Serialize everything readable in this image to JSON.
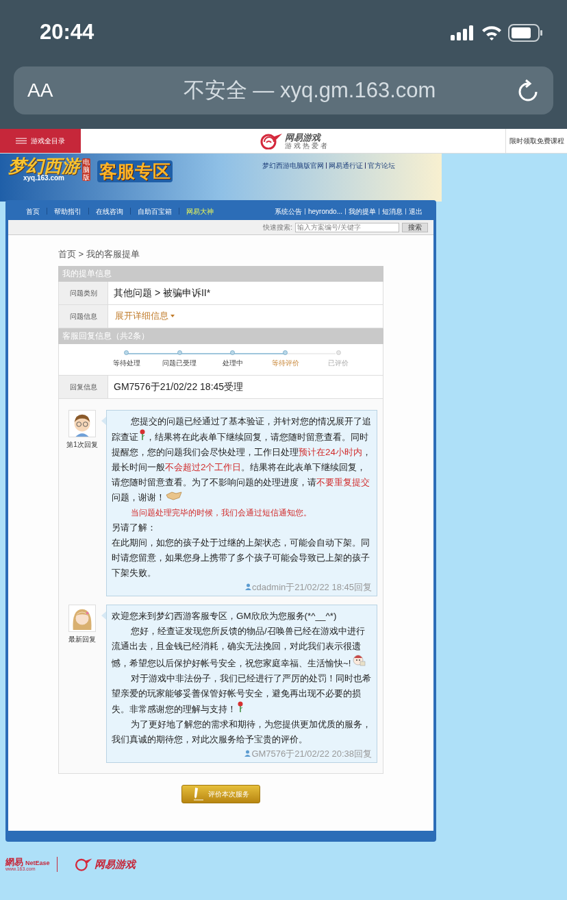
{
  "status_bar": {
    "time": "20:44"
  },
  "address_bar": {
    "text_size_button": "AA",
    "url": "不安全 — xyq.gm.163.com"
  },
  "site_bar": {
    "menu": "游戏全目录",
    "brand": "网易游戏",
    "brand_tagline": "游 戏 热 爱 者",
    "promo": "限时领取免费课程"
  },
  "banner": {
    "game_logo": "梦幻西游",
    "edition_badge": "电脑版",
    "game_url": "xyq.163.com",
    "title": "客服专区",
    "links": [
      "梦幻西游电脑版官网",
      "网易通行证",
      "官方论坛"
    ]
  },
  "nav": {
    "items": [
      {
        "label": "首页",
        "highlight": false
      },
      {
        "label": "帮助指引",
        "highlight": false
      },
      {
        "label": "在线咨询",
        "highlight": false
      },
      {
        "label": "自助百宝箱",
        "highlight": false
      },
      {
        "label": "网易大神",
        "highlight": true
      }
    ],
    "user_links": [
      "系统公告",
      "heyrondo...",
      "我的提单",
      "短消息",
      "退出"
    ]
  },
  "search": {
    "label": "快速搜索:",
    "placeholder": "输入方案编号/关键字",
    "button": "搜索"
  },
  "breadcrumb": "首页 > 我的客服提单",
  "ticket": {
    "heading": "我的提单信息",
    "rows": [
      {
        "label": "问题类别",
        "value": "其他问题 > 被骗申诉II*",
        "kind": "text"
      },
      {
        "label": "问题信息",
        "value": "展开详细信息",
        "kind": "link"
      }
    ]
  },
  "replies_section": {
    "heading": "客服回复信息（共2条）",
    "steps": [
      {
        "label": "等待处理",
        "completed": true,
        "selected": false
      },
      {
        "label": "问题已受理",
        "completed": true,
        "selected": false
      },
      {
        "label": "处理中",
        "completed": true,
        "selected": false
      },
      {
        "label": "等待评价",
        "completed": true,
        "selected": true
      },
      {
        "label": "已评价",
        "completed": false,
        "selected": false
      }
    ],
    "info_label": "回复信息",
    "info_value": "GM7576于21/02/22 18:45受理",
    "replies": [
      {
        "kind": "boy",
        "caption": "第1次回复",
        "paragraphs": [
          {
            "indent": true,
            "parts": [
              {
                "kind": "text",
                "text": "您提交的问题已经通过了基本验证，并针对您的情况展开了追踪查证"
              },
              {
                "kind": "rose"
              },
              {
                "kind": "text",
                "text": "，结果将在此表单下继续回复，请您随时留意查看。同时提醒您，您的问题我们会尽快处理，工作日处理"
              },
              {
                "kind": "alert",
                "text": "预计在24小时内"
              },
              {
                "kind": "text",
                "text": "，最长时间一般"
              },
              {
                "kind": "alert",
                "text": "不会超过2个工作日"
              },
              {
                "kind": "text",
                "text": "。结果将在此表单下继续回复，请您随时留意查看。为了不影响问题的处理进度，请"
              },
              {
                "kind": "alert",
                "text": "不要重复提交"
              },
              {
                "kind": "text",
                "text": "问题，谢谢！"
              },
              {
                "kind": "handshake"
              }
            ]
          },
          {
            "indent": true,
            "parts": [
              {
                "kind": "notice",
                "text": "当问题处理完毕的时候，我们会通过短信通知您。"
              }
            ]
          },
          {
            "indent": false,
            "parts": [
              {
                "kind": "text",
                "text": "另请了解："
              }
            ]
          },
          {
            "indent": false,
            "parts": [
              {
                "kind": "text",
                "text": "在此期间，如您的孩子处于过继的上架状态，可能会自动下架。同时请您留意，如果您身上携带了多个孩子可能会导致已上架的孩子下架失败。"
              }
            ]
          }
        ],
        "signature": "cdadmin于21/02/22 18:45回复"
      },
      {
        "kind": "girl",
        "caption": "最新回复",
        "paragraphs": [
          {
            "indent": false,
            "parts": [
              {
                "kind": "text",
                "text": "欢迎您来到梦幻西游客服专区，GM欣欣为您服务(*^__^*)"
              }
            ]
          },
          {
            "indent": true,
            "parts": [
              {
                "kind": "text",
                "text": "您好，经查证发现您所反馈的物品/召唤兽已经在游戏中进行流通出去，且金钱已经消耗，确实无法挽回，对此我们表示很遗憾，希望您以后保护好帐号安全，祝您家庭幸福、生活愉快~!"
              },
              {
                "kind": "doll"
              }
            ]
          },
          {
            "indent": true,
            "parts": [
              {
                "kind": "text",
                "text": "对于游戏中非法份子，我们已经进行了严厉的处罚！同时也希望亲爱的玩家能够妥善保管好帐号安全，避免再出现不必要的损失。非常感谢您的理解与支持！"
              },
              {
                "kind": "rose"
              }
            ]
          },
          {
            "indent": true,
            "parts": [
              {
                "kind": "text",
                "text": "为了更好地了解您的需求和期待，为您提供更加优质的服务，我们真诚的期待您，对此次服务给予宝贵的评价。"
              }
            ]
          }
        ],
        "signature": "GM7576于21/02/22 20:38回复"
      }
    ]
  },
  "rate_button": "评价本次服务",
  "footer": {
    "netease_logo": "網易",
    "netease_latin": "NetEase",
    "netease_url": "www.163.com",
    "games_logo": "网易游戏"
  }
}
